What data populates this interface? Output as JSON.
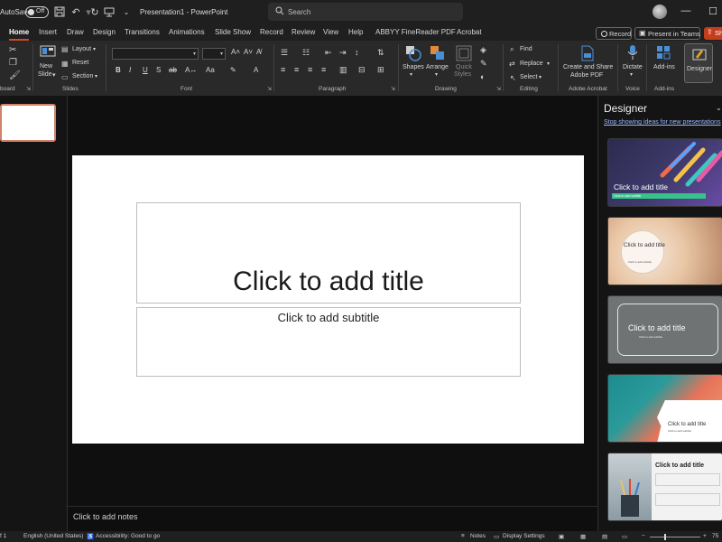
{
  "titlebar": {
    "autosave_label": "AutoSave",
    "autosave_state": "Off",
    "doc_title": "Presentation1  -  PowerPoint",
    "search_placeholder": "Search"
  },
  "menu": {
    "tabs": [
      "Home",
      "Insert",
      "Draw",
      "Design",
      "Transitions",
      "Animations",
      "Slide Show",
      "Record",
      "Review",
      "View",
      "Help",
      "ABBYY FineReader PDF",
      "Acrobat"
    ],
    "record_label": "Record",
    "present_label": "Present in Teams",
    "share_label": "Sh"
  },
  "ribbon": {
    "groups": {
      "clipboard": "board",
      "slides": "Slides",
      "font": "Font",
      "paragraph": "Paragraph",
      "drawing": "Drawing",
      "editing": "Editing",
      "adobe": "Adobe Acrobat",
      "voice": "Voice",
      "addins": "Add-ins"
    },
    "new_slide_line1": "New",
    "new_slide_line2": "Slide",
    "layout": "Layout",
    "reset": "Reset",
    "section": "Section",
    "shapes": "Shapes",
    "arrange": "Arrange",
    "quick_styles_line1": "Quick",
    "quick_styles_line2": "Styles",
    "find": "Find",
    "replace": "Replace",
    "select": "Select",
    "create_share_line1": "Create and Share",
    "create_share_line2": "Adobe PDF",
    "dictate": "Dictate",
    "addins_btn": "Add-ins",
    "designer_btn": "Designer"
  },
  "slide": {
    "title_placeholder": "Click to add title",
    "subtitle_placeholder": "Click to add subtitle"
  },
  "notes_placeholder": "Click to add notes",
  "designer": {
    "title": "Designer",
    "stop_link": "Stop showing ideas for new presentations",
    "cards": [
      {
        "title": "Click to add title",
        "subtitle": "Click to add subtitle"
      },
      {
        "title": "Click to add title",
        "subtitle": "Click to add subtitle"
      },
      {
        "title": "Click to add title",
        "subtitle": "Click to add subtitle"
      },
      {
        "title": "Click to add title",
        "subtitle": "Click to add subtitle"
      },
      {
        "title": "Click to add title",
        "subtitle": ""
      }
    ]
  },
  "statusbar": {
    "slide_count": "f 1",
    "language": "English (United States)",
    "accessibility": "Accessibility: Good to go",
    "notes": "Notes",
    "display_settings": "Display Settings",
    "zoom": "75"
  }
}
